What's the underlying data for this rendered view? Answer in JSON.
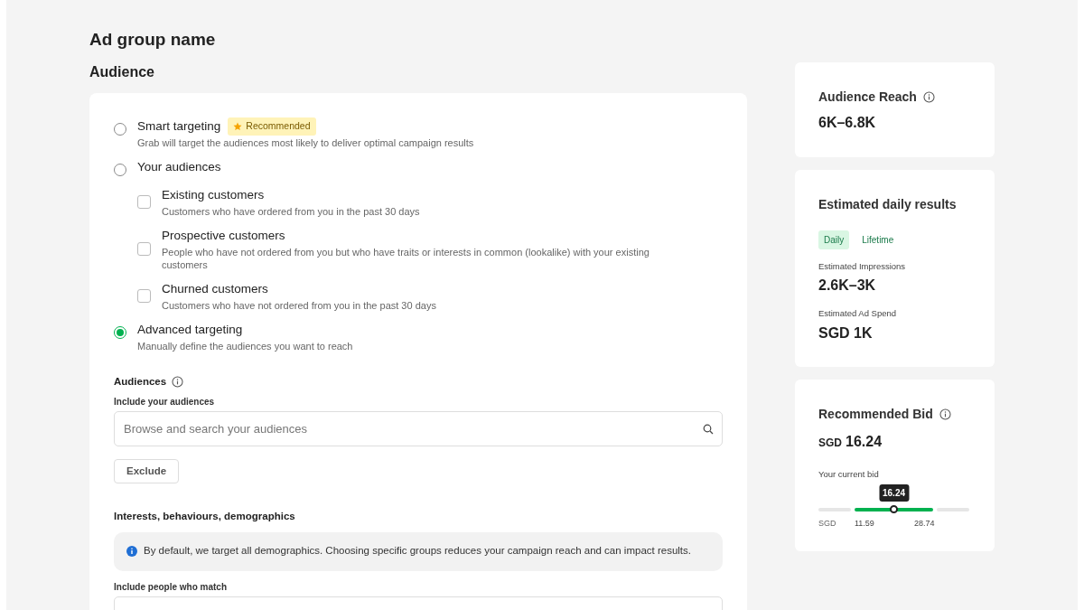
{
  "title": "Ad group name",
  "section_title": "Audience",
  "targeting_options": [
    {
      "kind": "radio",
      "label": "Smart targeting",
      "badge": "Recommended",
      "description": "Grab will target the audiences most likely to deliver optimal campaign results",
      "selected": false
    },
    {
      "kind": "radio",
      "label": "Your audiences",
      "selected": false
    },
    {
      "kind": "checkbox",
      "label": "Existing customers",
      "description": "Customers who have ordered from you in the past 30 days",
      "checked": false
    },
    {
      "kind": "checkbox",
      "label": "Prospective customers",
      "description": "People who have not ordered from you but who have traits or interests in common (lookalike) with your existing customers",
      "checked": false
    },
    {
      "kind": "checkbox",
      "label": "Churned customers",
      "description": "Customers who have not ordered from you in the past 30 days",
      "checked": false
    },
    {
      "kind": "radio",
      "label": "Advanced targeting",
      "description": "Manually define the audiences you want to reach",
      "selected": true
    }
  ],
  "audiences": {
    "title": "Audiences",
    "field_label": "Include your audiences",
    "search": {
      "placeholder": "Browse and search your audiences"
    },
    "exclude_button": "Exclude"
  },
  "interests": {
    "title": "Interests, behaviours, demographics",
    "info": "By default, we target all demographics. Choosing specific groups reduces your campaign reach and can impact results.",
    "field_label": "Include people who match"
  },
  "reach_card": {
    "title": "Audience Reach",
    "value": "6K–6.8K"
  },
  "results_card": {
    "title": "Estimated daily results",
    "tabs": [
      {
        "label": "Daily",
        "selected": true
      },
      {
        "label": "Lifetime",
        "selected": false
      }
    ],
    "metrics": [
      {
        "label": "Estimated Impressions",
        "value": "2.6K–3K"
      },
      {
        "label": "Estimated Ad Spend",
        "value": "SGD 1K"
      }
    ]
  },
  "bid_card": {
    "title": "Recommended Bid",
    "currency": "SGD",
    "value": "16.24",
    "slider_label": "Your current bid",
    "slider": {
      "tooltip": "16.24",
      "level": 0.5,
      "currency": "SGD",
      "min": "11.59",
      "max": "28.74"
    }
  }
}
